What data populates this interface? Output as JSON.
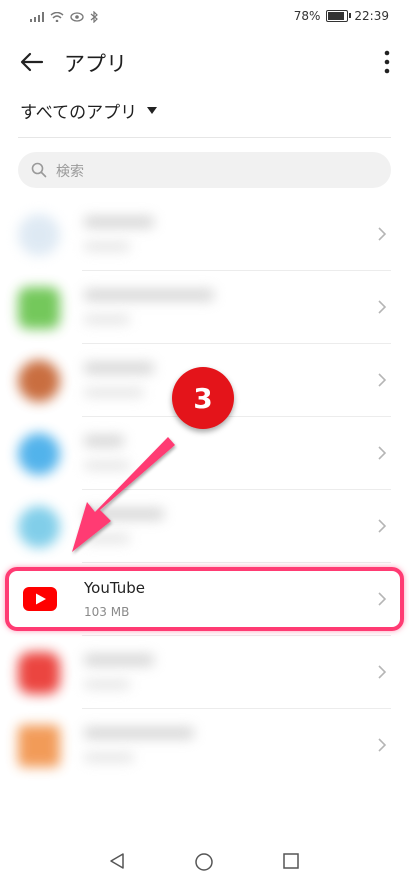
{
  "status_bar": {
    "battery": "78%",
    "time": "22:39"
  },
  "header": {
    "title": "アプリ"
  },
  "filter": {
    "label": "すべてのアプリ"
  },
  "search": {
    "placeholder": "検索"
  },
  "apps": [
    {
      "name": "YouTube",
      "size": "103 MB",
      "icon": "youtube-icon",
      "color": "#ff0000"
    }
  ],
  "annotation": {
    "step": "3",
    "accent": "#ff3b73"
  }
}
